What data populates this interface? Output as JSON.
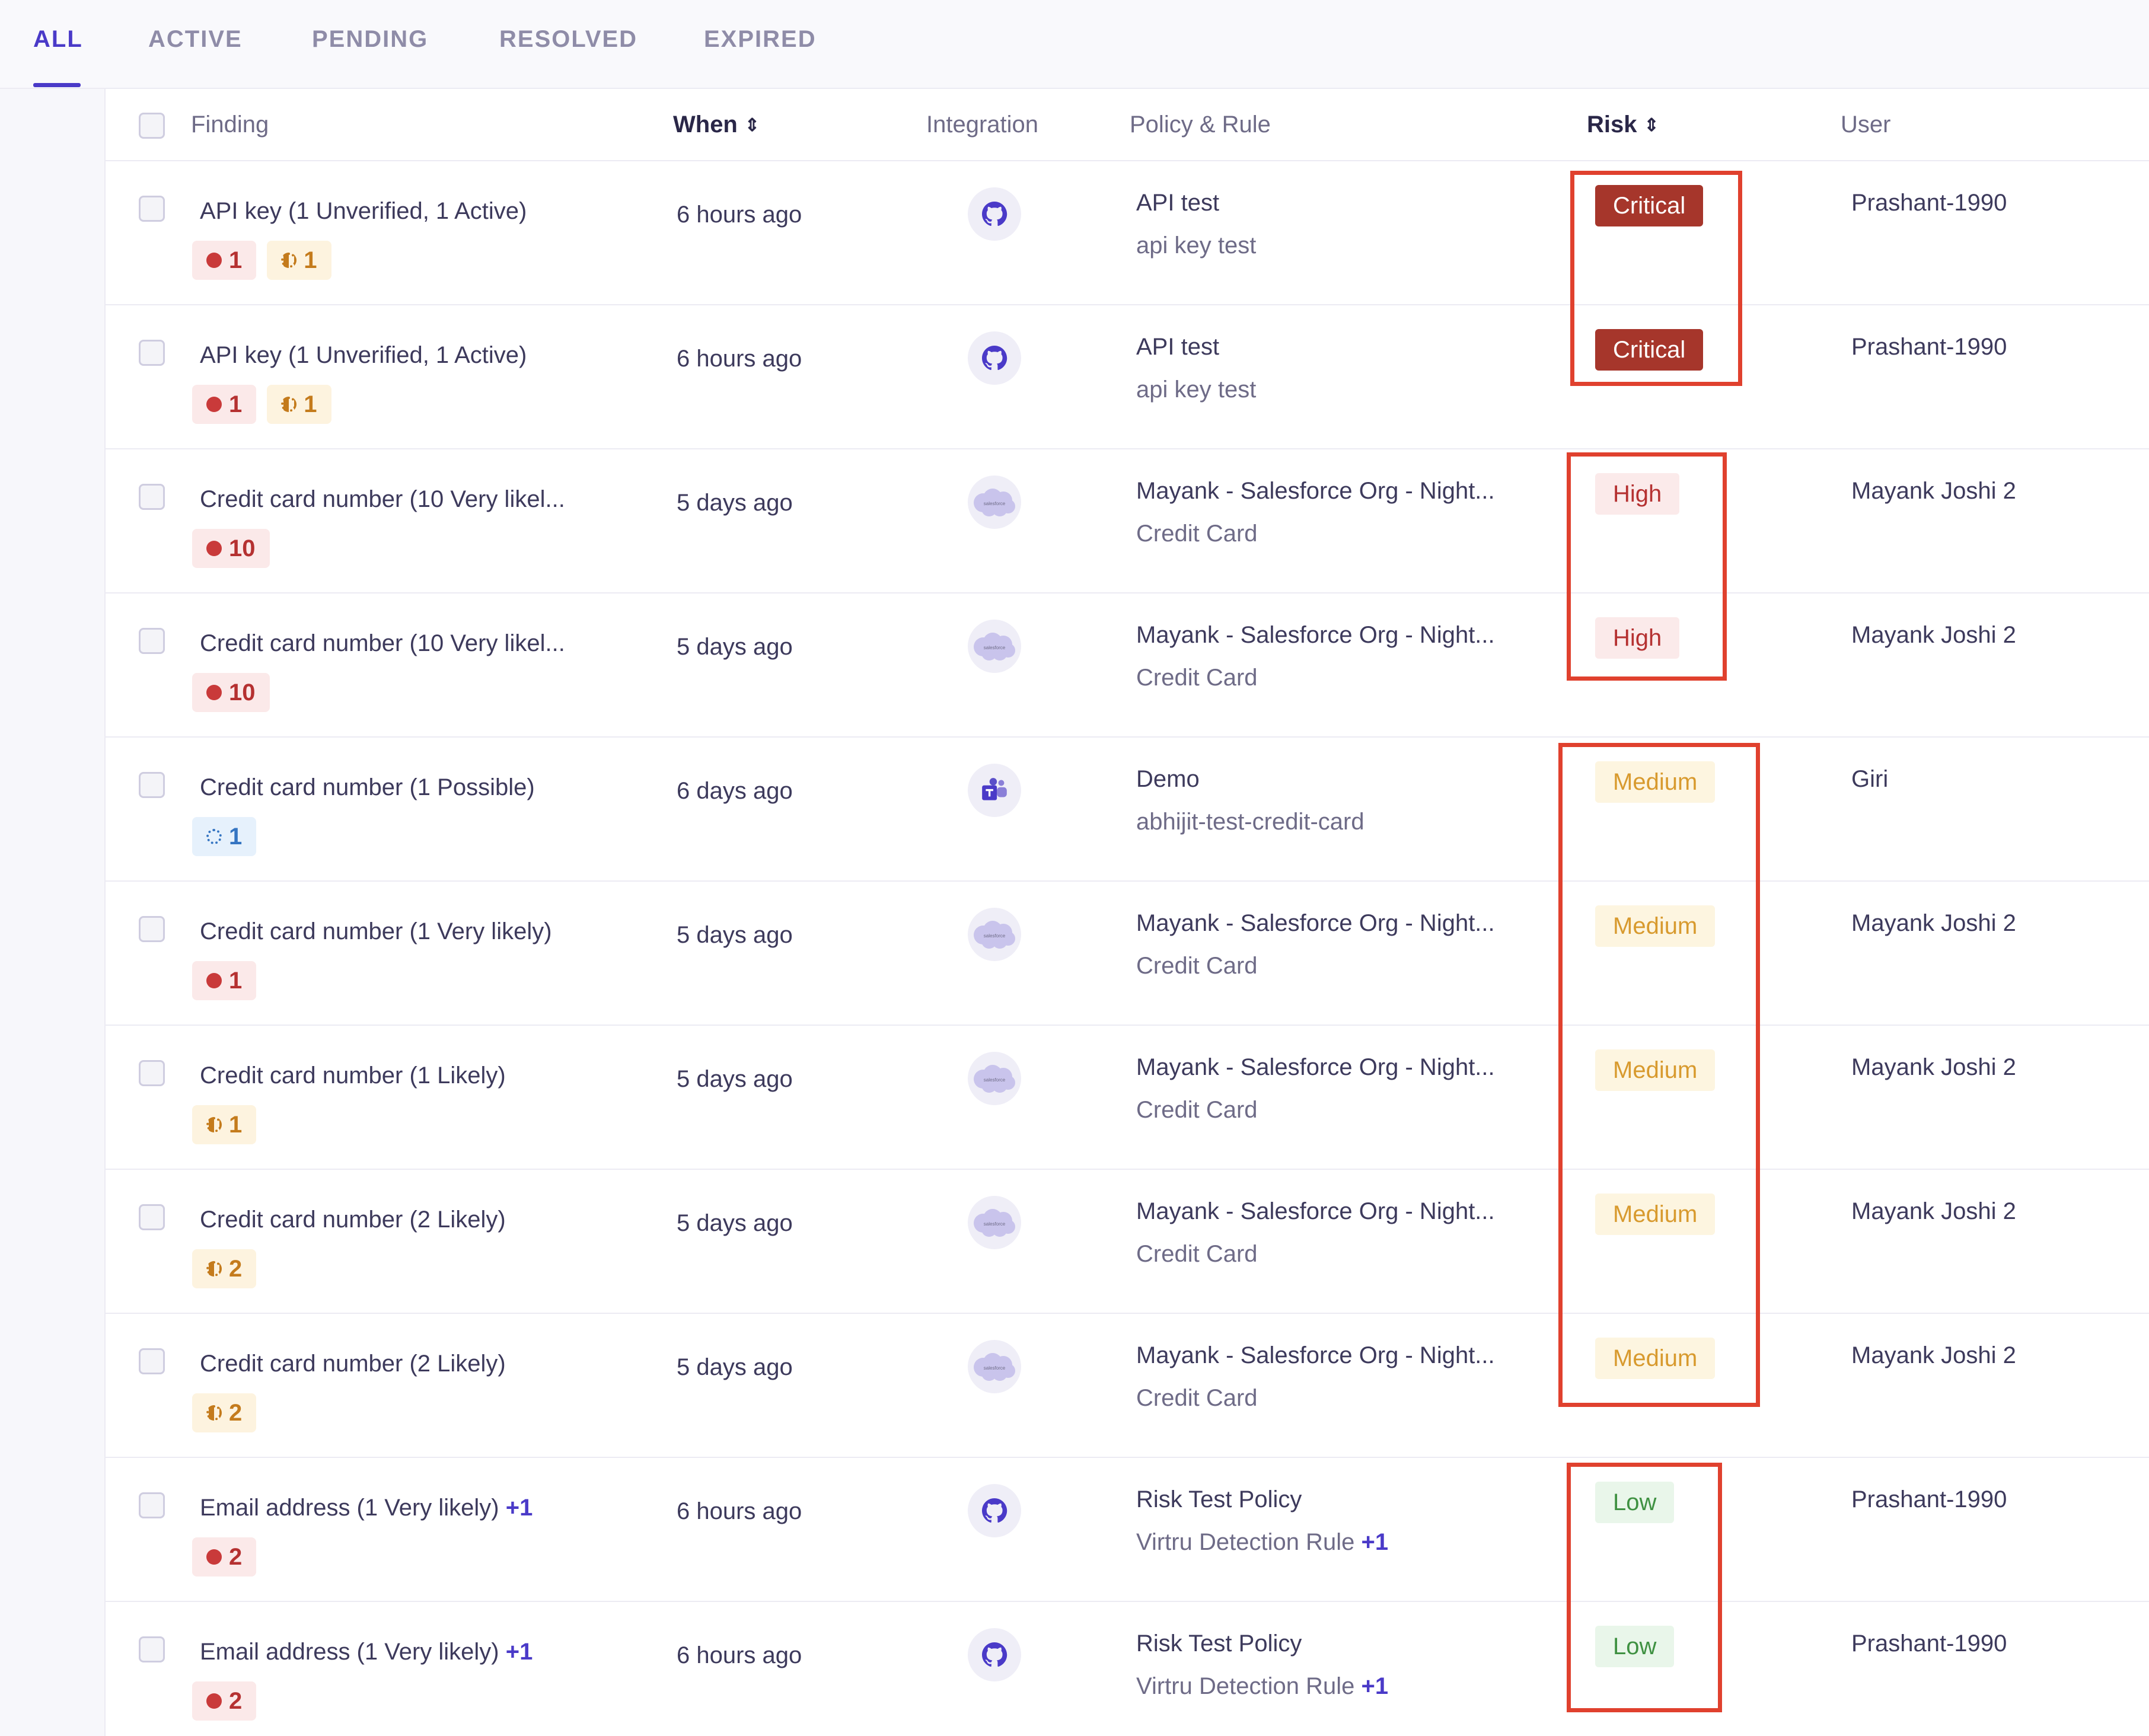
{
  "tabs": [
    "ALL",
    "ACTIVE",
    "PENDING",
    "RESOLVED",
    "EXPIRED"
  ],
  "columns": {
    "finding": "Finding",
    "when": "When",
    "integration": "Integration",
    "policy": "Policy & Rule",
    "risk": "Risk",
    "user": "User"
  },
  "rows": [
    {
      "finding": "API key (1 Unverified, 1 Active)",
      "finding_plus": "",
      "chips": [
        {
          "kind": "red",
          "icon": "dot-icon",
          "count": "1"
        },
        {
          "kind": "amber",
          "icon": "half-circle-icon",
          "count": "1"
        }
      ],
      "when": "6 hours ago",
      "integration": "github-icon",
      "policy": "API test",
      "rule": "api key test",
      "rule_plus": "",
      "risk": "Critical",
      "user": "Prashant-1990"
    },
    {
      "finding": "API key (1 Unverified, 1 Active)",
      "finding_plus": "",
      "chips": [
        {
          "kind": "red",
          "icon": "dot-icon",
          "count": "1"
        },
        {
          "kind": "amber",
          "icon": "half-circle-icon",
          "count": "1"
        }
      ],
      "when": "6 hours ago",
      "integration": "github-icon",
      "policy": "API test",
      "rule": "api key test",
      "rule_plus": "",
      "risk": "Critical",
      "user": "Prashant-1990"
    },
    {
      "finding": "Credit card number (10 Very likel...",
      "finding_plus": "",
      "chips": [
        {
          "kind": "red",
          "icon": "dot-icon",
          "count": "10"
        }
      ],
      "when": "5 days ago",
      "integration": "salesforce-icon",
      "policy": "Mayank - Salesforce Org - Night...",
      "rule": "Credit Card",
      "rule_plus": "",
      "risk": "High",
      "user": "Mayank Joshi 2"
    },
    {
      "finding": "Credit card number (10 Very likel...",
      "finding_plus": "",
      "chips": [
        {
          "kind": "red",
          "icon": "dot-icon",
          "count": "10"
        }
      ],
      "when": "5 days ago",
      "integration": "salesforce-icon",
      "policy": "Mayank - Salesforce Org - Night...",
      "rule": "Credit Card",
      "rule_plus": "",
      "risk": "High",
      "user": "Mayank Joshi 2"
    },
    {
      "finding": "Credit card number (1 Possible)",
      "finding_plus": "",
      "chips": [
        {
          "kind": "blue",
          "icon": "dotted-ring-icon",
          "count": "1"
        }
      ],
      "when": "6 days ago",
      "integration": "teams-icon",
      "policy": "Demo",
      "rule": "abhijit-test-credit-card",
      "rule_plus": "",
      "risk": "Medium",
      "user": "Giri"
    },
    {
      "finding": "Credit card number (1 Very likely)",
      "finding_plus": "",
      "chips": [
        {
          "kind": "red",
          "icon": "dot-icon",
          "count": "1"
        }
      ],
      "when": "5 days ago",
      "integration": "salesforce-icon",
      "policy": "Mayank - Salesforce Org - Night...",
      "rule": "Credit Card",
      "rule_plus": "",
      "risk": "Medium",
      "user": "Mayank Joshi 2"
    },
    {
      "finding": "Credit card number (1 Likely)",
      "finding_plus": "",
      "chips": [
        {
          "kind": "amber",
          "icon": "half-circle-icon",
          "count": "1"
        }
      ],
      "when": "5 days ago",
      "integration": "salesforce-icon",
      "policy": "Mayank - Salesforce Org - Night...",
      "rule": "Credit Card",
      "rule_plus": "",
      "risk": "Medium",
      "user": "Mayank Joshi 2"
    },
    {
      "finding": "Credit card number (2 Likely)",
      "finding_plus": "",
      "chips": [
        {
          "kind": "amber",
          "icon": "half-circle-icon",
          "count": "2"
        }
      ],
      "when": "5 days ago",
      "integration": "salesforce-icon",
      "policy": "Mayank - Salesforce Org - Night...",
      "rule": "Credit Card",
      "rule_plus": "",
      "risk": "Medium",
      "user": "Mayank Joshi 2"
    },
    {
      "finding": "Credit card number (2 Likely)",
      "finding_plus": "",
      "chips": [
        {
          "kind": "amber",
          "icon": "half-circle-icon",
          "count": "2"
        }
      ],
      "when": "5 days ago",
      "integration": "salesforce-icon",
      "policy": "Mayank - Salesforce Org - Night...",
      "rule": "Credit Card",
      "rule_plus": "",
      "risk": "Medium",
      "user": "Mayank Joshi 2"
    },
    {
      "finding": "Email address (1 Very likely)",
      "finding_plus": "+1",
      "chips": [
        {
          "kind": "red",
          "icon": "dot-icon",
          "count": "2"
        }
      ],
      "when": "6 hours ago",
      "integration": "github-icon",
      "policy": "Risk Test Policy",
      "rule": "Virtru Detection Rule",
      "rule_plus": "+1",
      "risk": "Low",
      "user": "Prashant-1990"
    },
    {
      "finding": "Email address (1 Very likely)",
      "finding_plus": "+1",
      "chips": [
        {
          "kind": "red",
          "icon": "dot-icon",
          "count": "2"
        }
      ],
      "when": "6 hours ago",
      "integration": "github-icon",
      "policy": "Risk Test Policy",
      "rule": "Virtru Detection Rule",
      "rule_plus": "+1",
      "risk": "Low",
      "user": "Prashant-1990"
    }
  ],
  "highlight_color": "#e0412e",
  "accent_color": "#4a3ac8"
}
